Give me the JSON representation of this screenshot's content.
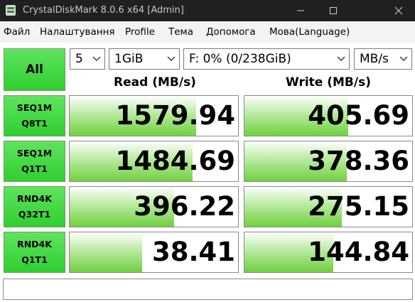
{
  "window": {
    "title": "CrystalDiskMark 8.0.6 x64 [Admin]"
  },
  "menu": [
    "Файл",
    "Налаштування",
    "Profile",
    "Тема",
    "Допомога",
    "Мова(Language)"
  ],
  "controls": {
    "all_label": "All",
    "count": "5",
    "size": "1GiB",
    "drive": "F: 0% (0/238GiB)",
    "unit": "MB/s"
  },
  "columns": {
    "read": "Read (MB/s)",
    "write": "Write (MB/s)"
  },
  "tests": [
    {
      "line1": "SEQ1M",
      "line2": "Q8T1",
      "read": "1579.94",
      "write": "405.69",
      "read_fill": 0.75,
      "write_fill": 0.62
    },
    {
      "line1": "SEQ1M",
      "line2": "Q1T1",
      "read": "1484.69",
      "write": "378.36",
      "read_fill": 0.73,
      "write_fill": 0.61
    },
    {
      "line1": "RND4K",
      "line2": "Q32T1",
      "read": "396.22",
      "write": "275.15",
      "read_fill": 0.62,
      "write_fill": 0.58
    },
    {
      "line1": "RND4K",
      "line2": "Q1T1",
      "read": "38.41",
      "write": "144.84",
      "read_fill": 0.43,
      "write_fill": 0.53
    }
  ],
  "comment": ""
}
